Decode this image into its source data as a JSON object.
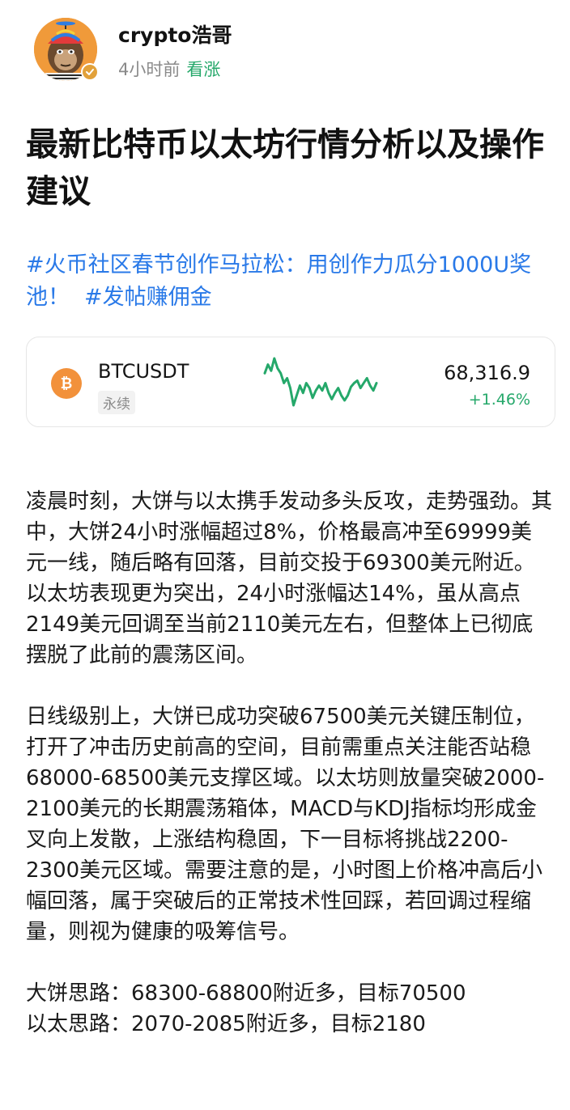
{
  "author": {
    "name": "crypto浩哥",
    "time": "4小时前",
    "sentiment": "看涨"
  },
  "post": {
    "title": "最新比特币以太坊行情分析以及操作建议",
    "tags": [
      "#火币社区春节创作马拉松：用创作力瓜分1000U奖池！",
      "#发帖赚佣金"
    ],
    "paragraphs": [
      "凌晨时刻，大饼与以太携手发动多头反攻，走势强劲。其中，大饼24小时涨幅超过8%，价格最高冲至69999美元一线，随后略有回落，目前交投于69300美元附近。以太坊表现更为突出，24小时涨幅达14%，虽从高点2149美元回调至当前2110美元左右，但整体上已彻底摆脱了此前的震荡区间。",
      "日线级别上，大饼已成功突破67500美元关键压制位，打开了冲击历史前高的空间，目前需重点关注能否站稳68000-68500美元支撑区域。以太坊则放量突破2000-2100美元的长期震荡箱体，MACD与KDJ指标均形成金叉向上发散，上涨结构稳固，下一目标将挑战2200-2300美元区域。需要注意的是，小时图上价格冲高后小幅回落，属于突破后的正常技术性回踩，若回调过程缩量，则视为健康的吸筹信号。",
      "大饼思路：68300-68800附近多，目标70500\n以太思路：2070-2085附近多，目标2180"
    ]
  },
  "ticker": {
    "symbol": "BTCUSDT",
    "contract_type": "永续",
    "price": "68,316.9",
    "change": "+1.46%",
    "coin_icon": "bitcoin-icon",
    "up_color": "#25a86a",
    "sparkline": [
      62,
      55,
      60,
      50,
      58,
      62,
      70,
      66,
      74,
      88,
      80,
      72,
      78,
      70,
      74,
      82,
      76,
      72,
      76,
      70,
      78,
      83,
      78,
      74,
      80,
      84,
      80,
      73,
      70,
      68,
      74,
      70,
      66,
      72,
      76,
      70
    ]
  },
  "colors": {
    "link": "#2979e8",
    "positive": "#25a86a",
    "muted": "#8a8a8a"
  }
}
